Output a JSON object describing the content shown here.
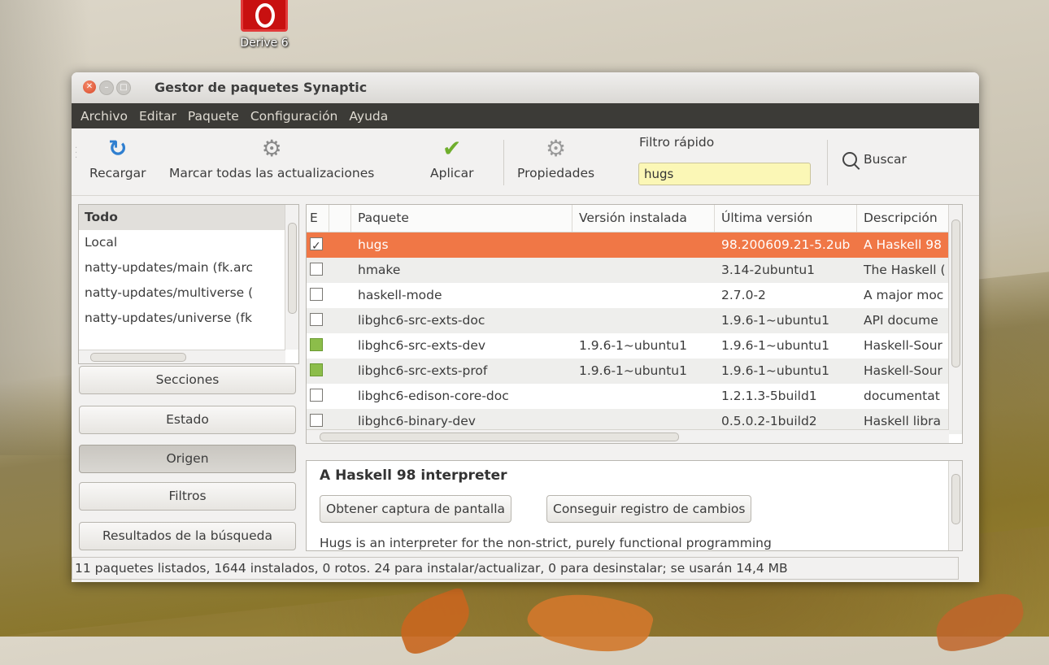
{
  "desktop": {
    "icon_label": "Derive 6"
  },
  "window": {
    "title": "Gestor de paquetes Synaptic"
  },
  "menu": [
    "Archivo",
    "Editar",
    "Paquete",
    "Configuración",
    "Ayuda"
  ],
  "toolbar": {
    "reload_label": "Recargar",
    "mark_all_label": "Marcar todas las actualizaciones",
    "apply_label": "Aplicar",
    "properties_label": "Propiedades",
    "quick_filter_label": "Filtro rápido",
    "quick_filter_value": "hugs",
    "search_label": "Buscar"
  },
  "origins": [
    {
      "label": "Todo",
      "selected": true
    },
    {
      "label": "Local",
      "selected": false
    },
    {
      "label": "natty-updates/main (fk.arc",
      "selected": false
    },
    {
      "label": "natty-updates/multiverse (",
      "selected": false
    },
    {
      "label": "natty-updates/universe (fk",
      "selected": false
    }
  ],
  "left_buttons": {
    "sections": "Secciones",
    "status": "Estado",
    "origin": "Origen",
    "filters": "Filtros",
    "search_results": "Resultados de la búsqueda"
  },
  "table": {
    "headers": [
      "E",
      "Paquete",
      "Versión instalada",
      "Última versión",
      "Descripción"
    ],
    "rows": [
      {
        "status": "checked",
        "name": "hugs",
        "installed": "",
        "latest": "98.200609.21-5.2ub",
        "desc": "A Haskell 98",
        "selected": true
      },
      {
        "status": "none",
        "name": "hmake",
        "installed": "",
        "latest": "3.14-2ubuntu1",
        "desc": "The Haskell (",
        "selected": false
      },
      {
        "status": "none",
        "name": "haskell-mode",
        "installed": "",
        "latest": "2.7.0-2",
        "desc": "A major moc",
        "selected": false
      },
      {
        "status": "none",
        "name": "libghc6-src-exts-doc",
        "installed": "",
        "latest": "1.9.6-1~ubuntu1",
        "desc": "API docume",
        "selected": false
      },
      {
        "status": "installed",
        "name": "libghc6-src-exts-dev",
        "installed": "1.9.6-1~ubuntu1",
        "latest": "1.9.6-1~ubuntu1",
        "desc": "Haskell-Sour",
        "selected": false
      },
      {
        "status": "installed",
        "name": "libghc6-src-exts-prof",
        "installed": "1.9.6-1~ubuntu1",
        "latest": "1.9.6-1~ubuntu1",
        "desc": "Haskell-Sour",
        "selected": false
      },
      {
        "status": "none",
        "name": "libghc6-edison-core-doc",
        "installed": "",
        "latest": "1.2.1.3-5build1",
        "desc": "documentat",
        "selected": false
      },
      {
        "status": "none",
        "name": "libghc6-binary-dev",
        "installed": "",
        "latest": "0.5.0.2-1build2",
        "desc": "Haskell libra",
        "selected": false
      }
    ]
  },
  "description": {
    "title": "A Haskell 98 interpreter",
    "screenshot_button": "Obtener captura de pantalla",
    "changelog_button": "Conseguir registro de cambios",
    "text": "Hugs is an interpreter for the non-strict, purely functional programming"
  },
  "status_bar": "11 paquetes listados, 1644 instalados, 0 rotos. 24 para instalar/actualizar, 0 para desinstalar; se usarán 14,4 MB",
  "colors": {
    "selection": "#f07746",
    "menubar": "#3c3b37",
    "installed": "#8cbd4a",
    "quick_filter_bg": "#fbf7b6"
  }
}
